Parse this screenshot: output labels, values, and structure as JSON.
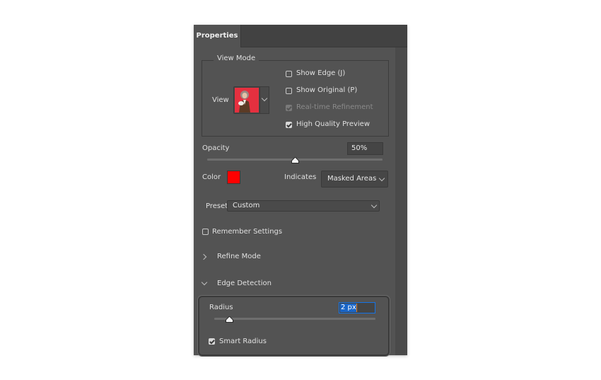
{
  "panel": {
    "tab_label": "Properties"
  },
  "view_mode": {
    "legend": "View Mode",
    "view_label": "View",
    "thumbnail_icon": "portrait-thumbnail",
    "dropdown_icon": "chevron-down-icon",
    "options": [
      {
        "label": "Show Edge (J)",
        "checked": false,
        "disabled": false
      },
      {
        "label": "Show Original (P)",
        "checked": false,
        "disabled": false
      },
      {
        "label": "Real-time Refinement",
        "checked": true,
        "disabled": true
      },
      {
        "label": "High Quality Preview",
        "checked": true,
        "disabled": false
      }
    ]
  },
  "opacity": {
    "label": "Opacity",
    "value": "50%",
    "slider_fraction": 0.5
  },
  "color": {
    "label": "Color",
    "swatch": "#ff0000"
  },
  "indicates": {
    "label": "Indicates",
    "value": "Masked Areas"
  },
  "preset": {
    "label": "Preset",
    "value": "Custom"
  },
  "remember_settings": {
    "label": "Remember Settings",
    "checked": false
  },
  "sections": {
    "refine_mode": {
      "label": "Refine Mode",
      "expanded": false
    },
    "edge_detection": {
      "label": "Edge Detection",
      "expanded": true
    }
  },
  "edge_detection": {
    "radius_label": "Radius",
    "radius_value": "2 px",
    "radius_slider_fraction": 0.09,
    "smart_radius_label": "Smart Radius",
    "smart_radius_checked": true
  },
  "colors": {
    "panel_bg": "#535353",
    "selection_blue": "#1a66c8",
    "focus_border": "#1473e6"
  }
}
